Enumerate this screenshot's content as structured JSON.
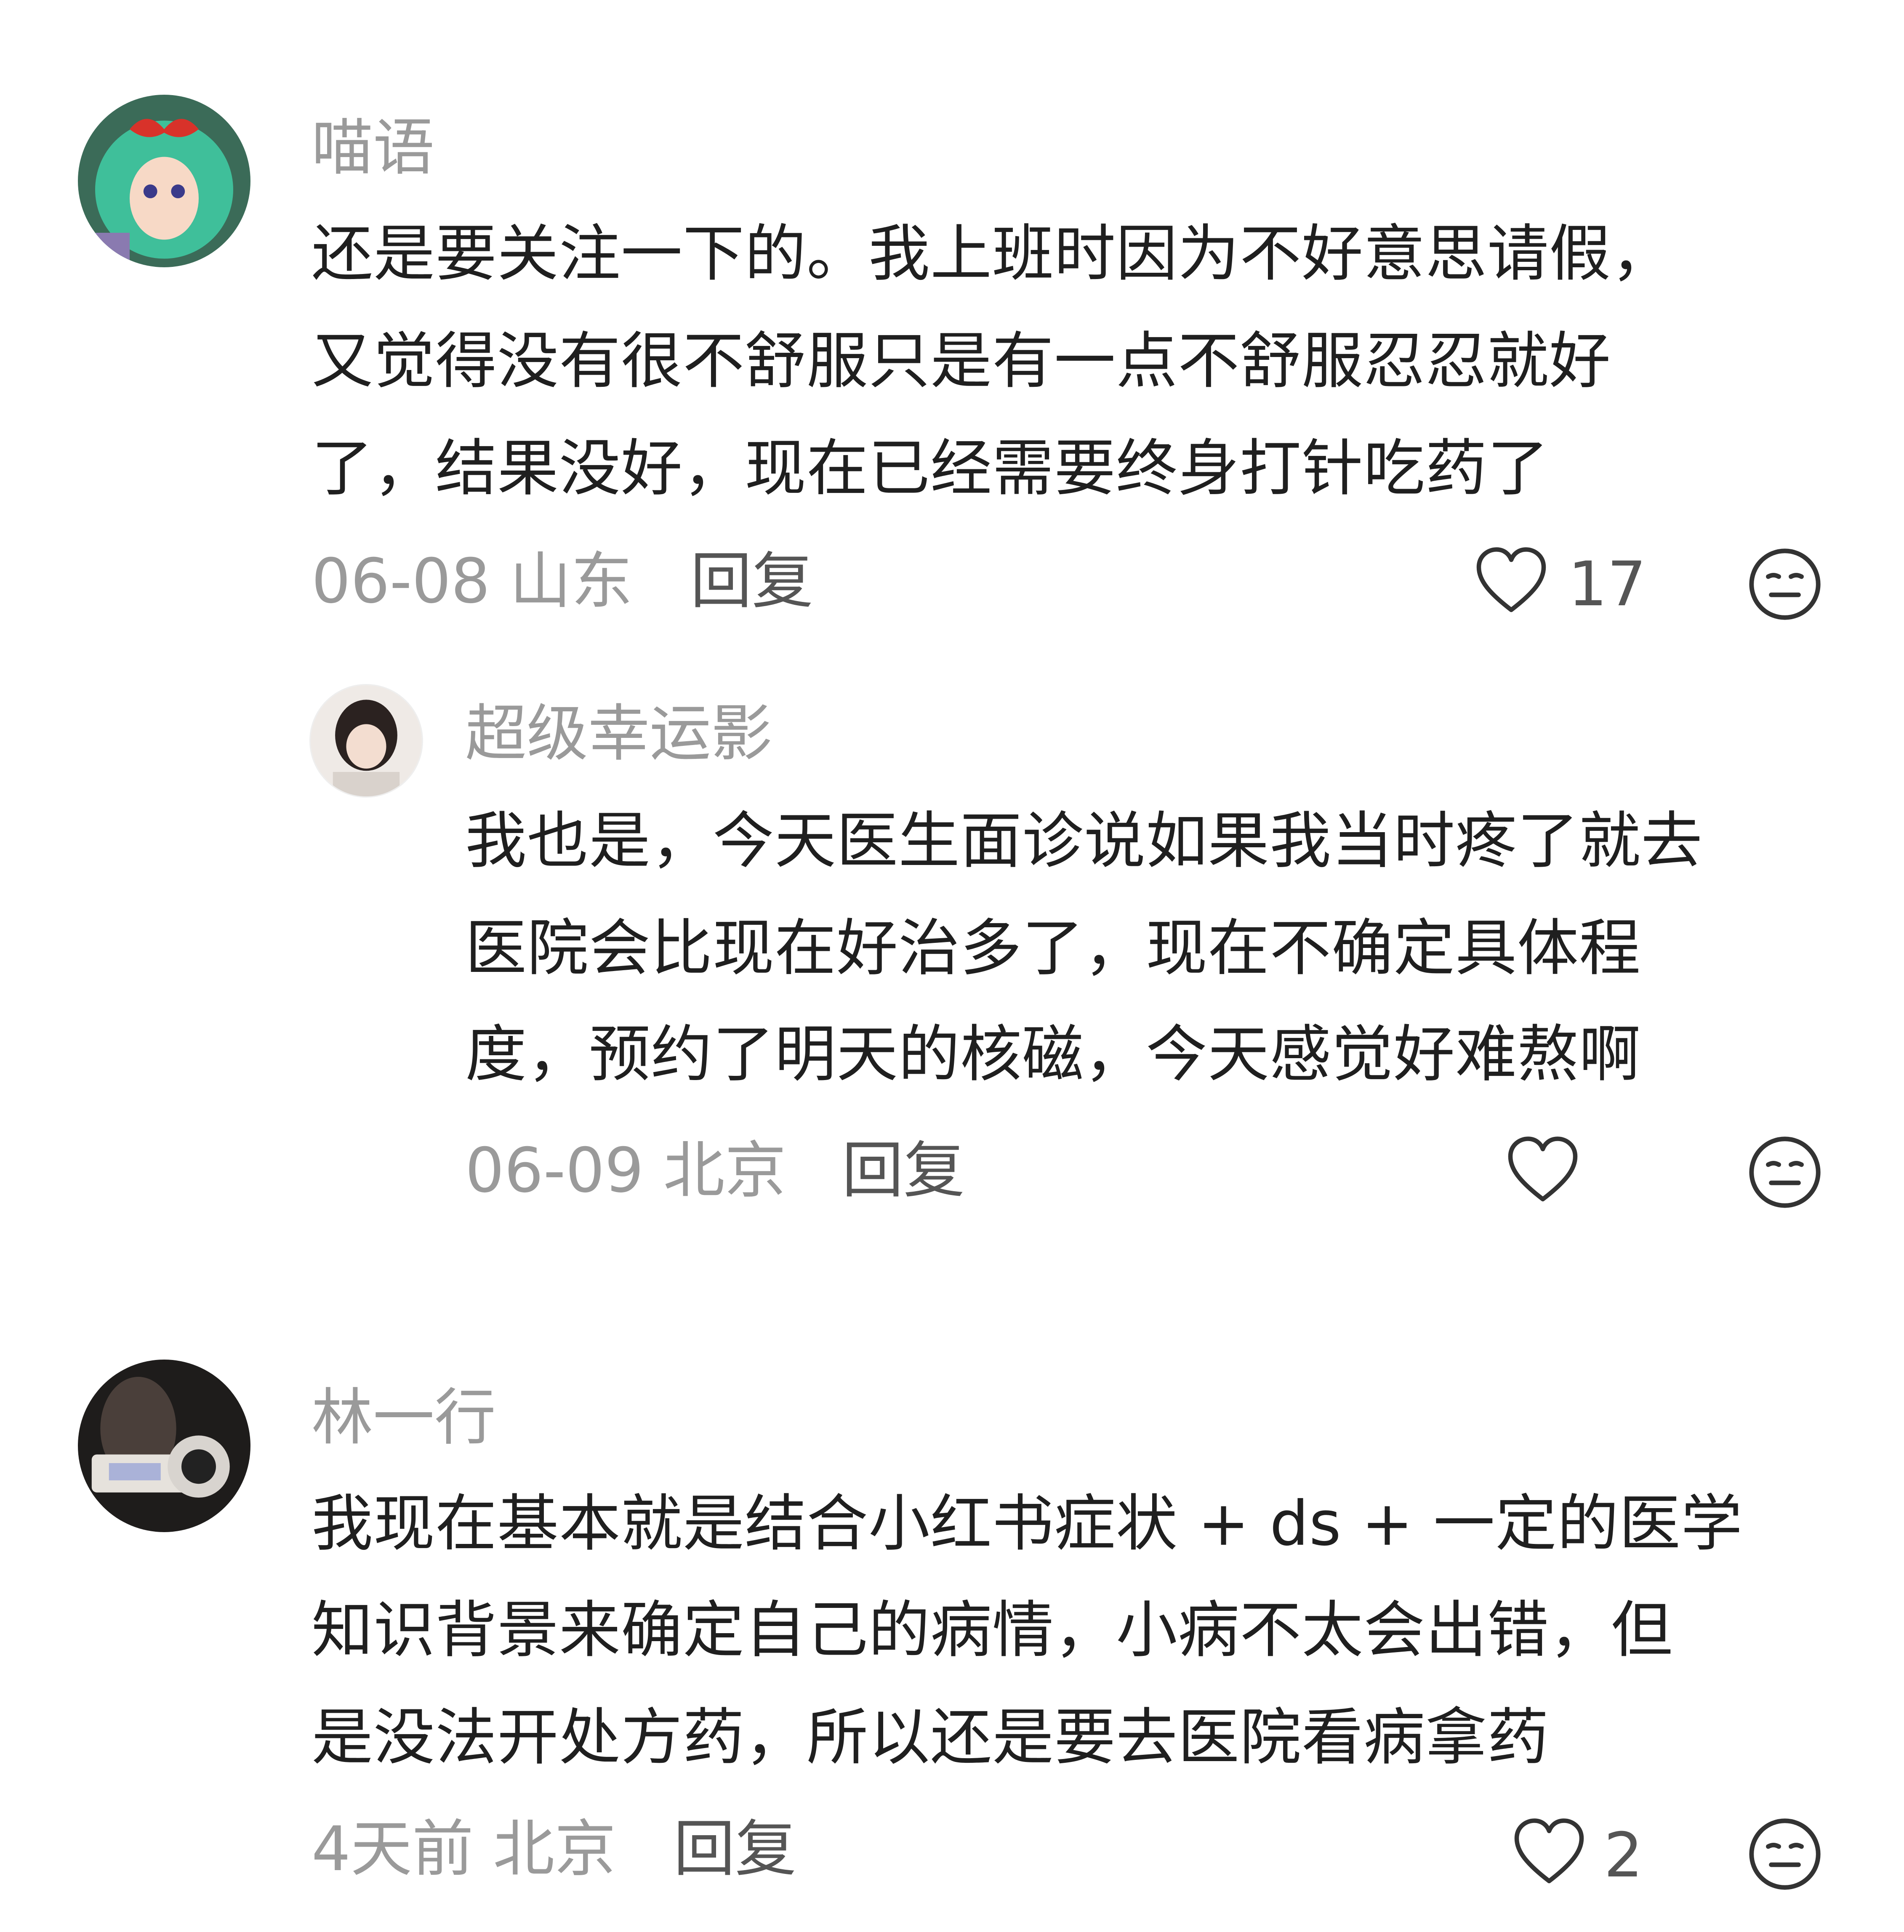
{
  "comments": [
    {
      "username": "喵语",
      "lines": [
        "还是要关注一下的。我上班时因为不好意思请假，",
        "又觉得没有很不舒服只是有一点不舒服忍忍就好",
        "了，结果没好，现在已经需要终身打针吃药了"
      ],
      "meta": "06-08 山东",
      "reply_label": "回复",
      "likes": "17"
    },
    {
      "username": "超级幸运影",
      "lines": [
        "我也是，今天医生面诊说如果我当时疼了就去",
        "医院会比现在好治多了，现在不确定具体程",
        "度，预约了明天的核磁，今天感觉好难熬啊"
      ],
      "meta": "06-09 北京",
      "reply_label": "回复",
      "likes": ""
    },
    {
      "username": "林一行",
      "lines": [
        "我现在基本就是结合小红书症状 + ds + 一定的医学",
        "知识背景来确定自己的病情，小病不太会出错，但",
        "是没法开处方药，所以还是要去医院看病拿药"
      ],
      "meta": "4天前 北京",
      "reply_label": "回复",
      "likes": "2"
    }
  ]
}
